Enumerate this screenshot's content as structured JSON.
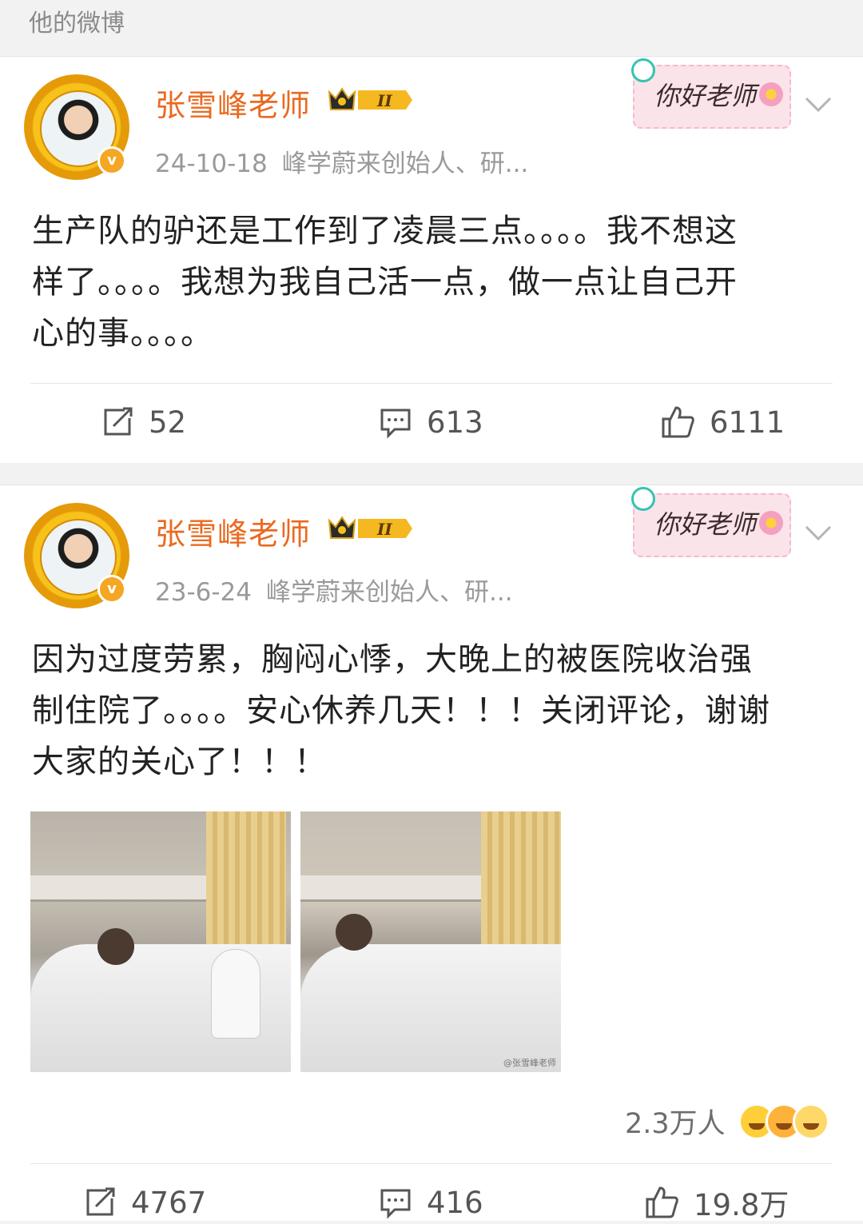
{
  "section": {
    "title": "他的微博"
  },
  "posts": [
    {
      "author": "张雪峰老师",
      "level": "II",
      "date": "24-10-18",
      "source": "峰学蔚来创始人、研...",
      "sticker": "你好老师",
      "text_lines": [
        "生产队的驴还是工作到了凌晨三点。。。。我不想这",
        "样了。。。。我想为我自己活一点，做一点让自己开",
        "心的事。。。。"
      ],
      "reposts": "52",
      "comments": "613",
      "likes": "6111"
    },
    {
      "author": "张雪峰老师",
      "level": "II",
      "date": "23-6-24",
      "source": "峰学蔚来创始人、研...",
      "sticker": "你好老师",
      "text_lines": [
        "因为过度劳累，胸闷心悸，大晚上的被医院收治强",
        "制住院了。。。。安心休养几天！！！关闭评论，谢谢",
        "大家的关心了！！！"
      ],
      "photo_watermark": "@张雪峰老师",
      "reaction_count": "2.3万人",
      "reposts": "4767",
      "comments": "416",
      "likes": "19.8万"
    }
  ],
  "colors": {
    "username": "#ea6a20",
    "meta": "#9a9a9a",
    "badge": "#f5a623"
  },
  "icons": [
    "chevron-down-icon",
    "repost-icon",
    "comment-icon",
    "like-icon",
    "crown-icon",
    "verified-icon"
  ]
}
